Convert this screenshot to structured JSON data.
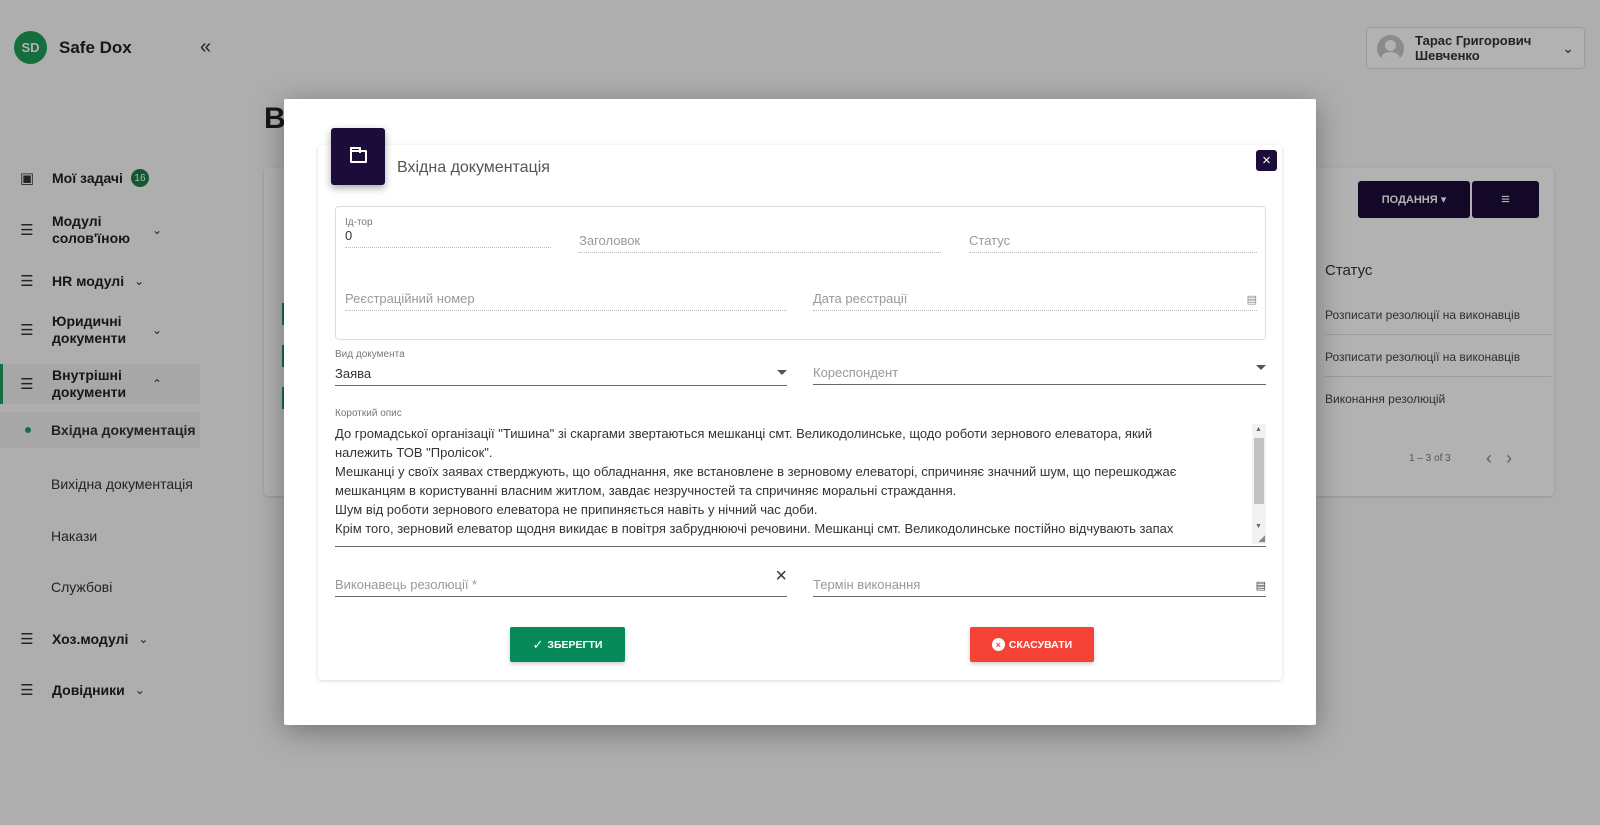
{
  "app": {
    "logo_initials": "SD",
    "logo_name": "Safe Dox",
    "collapse_icon": "«",
    "user_name": "Тарас Григорович Шевченко",
    "page_title_partial": "В"
  },
  "sidebar": {
    "items": [
      {
        "label": "Мої задачі",
        "badge": "16"
      },
      {
        "label": "Модулі солов'їною"
      },
      {
        "label": "HR модулі"
      },
      {
        "label": "Юридичні документи"
      },
      {
        "label": "Внутрішні документи"
      },
      {
        "label": "Хоз.модулі"
      },
      {
        "label": "Довідники"
      }
    ],
    "subitems": [
      {
        "label": "Вхідна документація"
      },
      {
        "label": "Вихідна документація"
      },
      {
        "label": "Накази"
      },
      {
        "label": "Службові"
      }
    ]
  },
  "background_table": {
    "submit_button": "ПОДАННЯ",
    "column_status": "Статус",
    "rows": [
      "Розписати резолюції на виконавців",
      "Розписати резолюції на виконавців",
      "Виконання резолюцій"
    ],
    "pager": "1 – 3 of 3"
  },
  "modal": {
    "title": "Вхідна документація",
    "close_glyph": "×",
    "fields": {
      "id_label": "Ід-тор",
      "id_value": "0",
      "title_placeholder": "Заголовок",
      "status_placeholder": "Статус",
      "reg_number_placeholder": "Реєстраційний номер",
      "reg_date_placeholder": "Дата реєстрації",
      "doc_type_label": "Вид документа",
      "doc_type_value": "Заява",
      "correspondent_placeholder": "Кореспондент",
      "description_label": "Короткий опис",
      "description_lines": [
        "До громадської організації \"Тишина\" зі скаргами звертаються мешканці смт. Великодолинське, щодо роботи зернового елеватора, який",
        "належить ТОВ \"Пролісок\".",
        "Мешканці у своїх заявах стверджують, що обладнання, яке встановлене в зерновому елеваторі, спричиняє значний шум, що перешкоджає",
        "мешканцям в користуванні власним житлом, завдає незручностей та спричиняє моральні страждання.",
        "Шум від роботи зернового елеватора не припиняється навіть у нічний час доби.",
        "Крім того, зерновий елеватор щодня викидає в повітря забруднюючі речовини. Мешканці смт. Великодолинське постійно відчувають запах"
      ],
      "executor_placeholder": "Виконавець резолюції *",
      "deadline_placeholder": "Термін виконання"
    },
    "save_label": "ЗБЕРЕГТИ",
    "cancel_label": "СКАСУВАТИ"
  }
}
